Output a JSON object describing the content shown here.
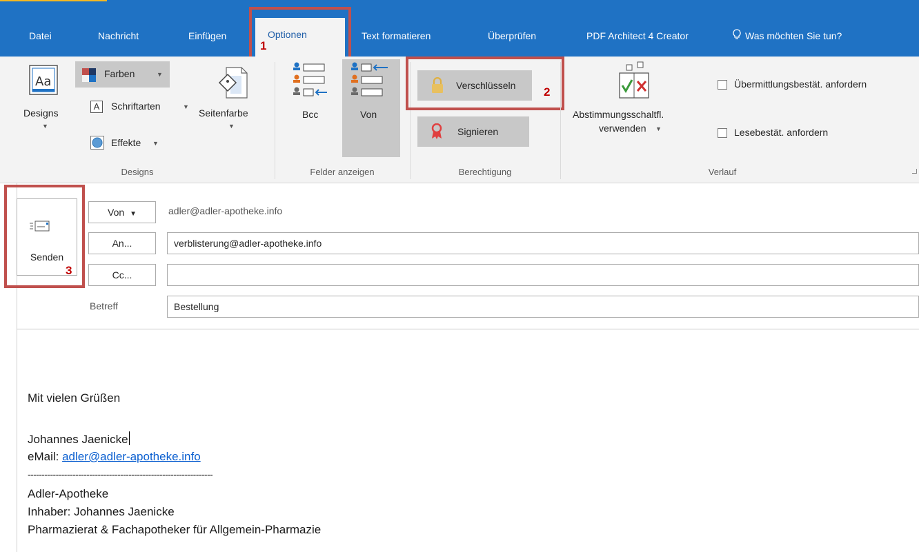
{
  "tabs": [
    "Datei",
    "Nachricht",
    "Einfügen",
    "Optionen",
    "Text formatieren",
    "Überprüfen",
    "PDF Architect 4 Creator"
  ],
  "search": {
    "label": "Was möchten Sie tun?"
  },
  "ribbon": {
    "designs": {
      "group_label": "Designs",
      "designs_label": "Designs",
      "farben_label": "Farben",
      "schriftarten_label": "Schriftarten",
      "effekte_label": "Effekte",
      "seitenfarbe_label": "Seitenfarbe"
    },
    "felder": {
      "group_label": "Felder anzeigen",
      "bcc_label": "Bcc",
      "von_label": "Von"
    },
    "berechtigung": {
      "group_label": "Berechtigung",
      "verschluesseln_label": "Verschlüsseln",
      "signieren_label": "Signieren"
    },
    "verlauf": {
      "group_label": "Verlauf",
      "abstimmung_line1": "Abstimmungsschaltfl.",
      "abstimmung_line2": "verwenden",
      "uebermittlung_label": "Übermittlungsbestät. anfordern",
      "lesebestaet_label": "Lesebestät. anfordern"
    }
  },
  "annotations": {
    "one": "1",
    "two": "2",
    "three": "3"
  },
  "compose": {
    "send_label": "Senden",
    "von_button": "Von",
    "from_value": "adler@adler-apotheke.info",
    "an_button": "An...",
    "to_value": "verblisterung@adler-apotheke.info",
    "cc_button": "Cc...",
    "cc_value": "",
    "subject_label": "Betreff",
    "subject_value": "Bestellung"
  },
  "body": {
    "greeting": "Mit vielen Grüßen",
    "name": "Johannes Jaenicke",
    "email_label": "eMail: ",
    "email_link": "adler@adler-apotheke.info",
    "separator": "------------------------------------------------------------------",
    "company": "Adler-Apotheke",
    "owner": "Inhaber: Johannes Jaenicke",
    "title": "Pharmazierat & Fachapotheker für Allgemein-Pharmazie"
  },
  "colors": {
    "tab_bar": "#1f72c4",
    "ribbon_bg": "#f3f3f3",
    "highlight": "#c0504d",
    "annotation": "#c00000",
    "link": "#0b5fd0"
  }
}
